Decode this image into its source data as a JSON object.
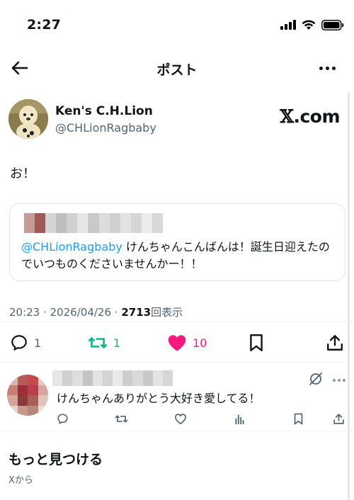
{
  "status_bar": {
    "time": "2:27"
  },
  "topbar": {
    "title": "ポスト"
  },
  "author": {
    "name": "Ken's C.H.Lion",
    "handle": "@CHLionRagbaby",
    "brand_x": "𝕏",
    "brand_suffix": ".com"
  },
  "post": {
    "text": "お！"
  },
  "quote": {
    "mention": "@CHLionRagbaby",
    "text": " けんちゃんこんばんは！誕生日迎えたのでいつものくださいませんかー！！"
  },
  "meta": {
    "time": "20:23",
    "sep1": " · ",
    "date": "2026/04/26",
    "sep2": " · ",
    "views": "2713",
    "views_label": "回表示"
  },
  "actions": {
    "reply_count": "1",
    "repost_count": "1",
    "like_count": "10"
  },
  "colors": {
    "repost": "#00ba7c",
    "like": "#f91880",
    "mention": "#1d9bf0",
    "secondary": "#536471"
  },
  "reply": {
    "text": "けんちゃんありがとう大好き愛してる！"
  },
  "discover": {
    "title": "もっと見つける",
    "subtitle": "Xから"
  }
}
